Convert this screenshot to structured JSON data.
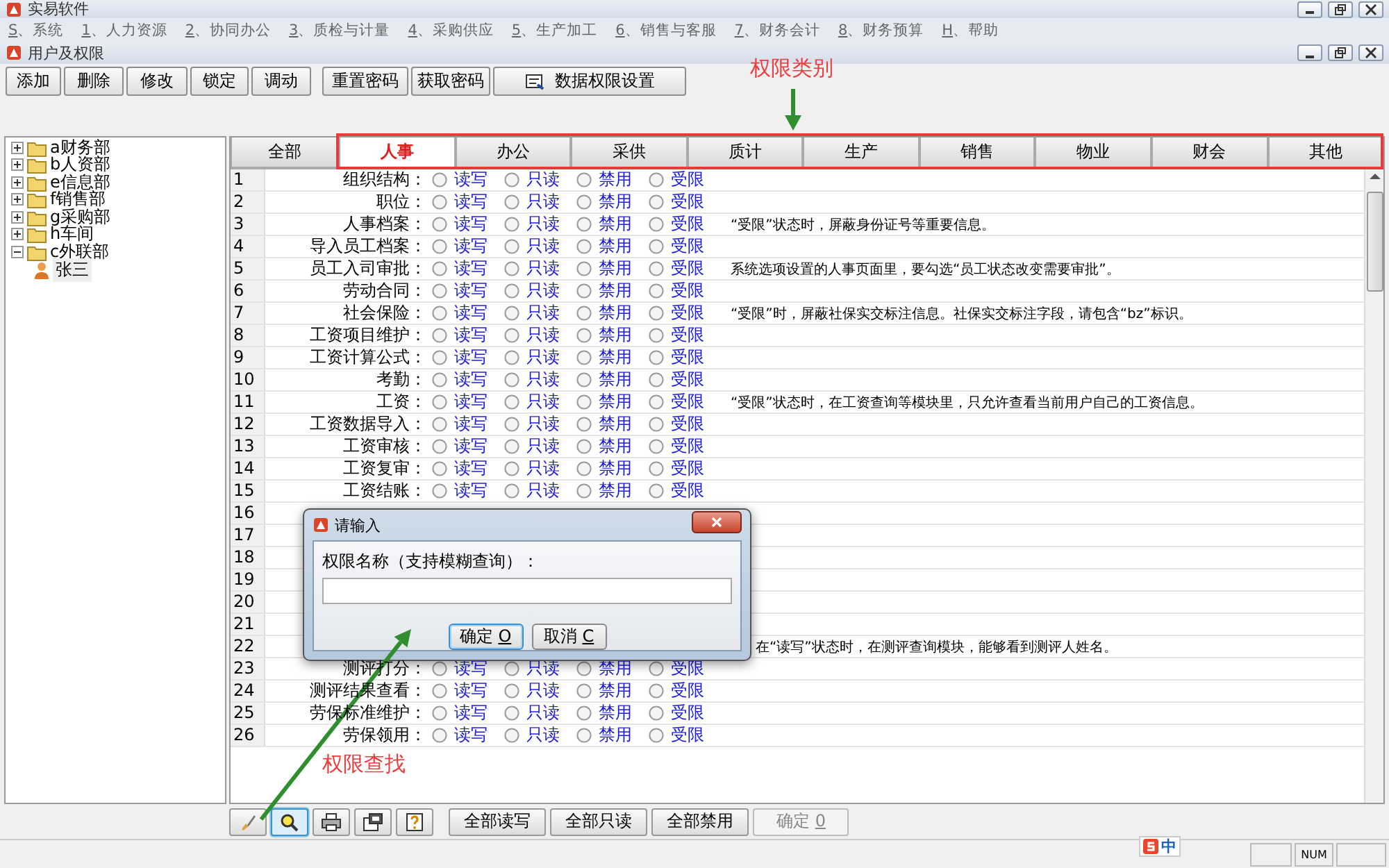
{
  "window": {
    "title": "实易软件"
  },
  "menu": [
    {
      "key": "S",
      "label": "、系统"
    },
    {
      "key": "1",
      "label": "、人力资源"
    },
    {
      "key": "2",
      "label": "、协同办公"
    },
    {
      "key": "3",
      "label": "、质检与计量"
    },
    {
      "key": "4",
      "label": "、采购供应"
    },
    {
      "key": "5",
      "label": "、生产加工"
    },
    {
      "key": "6",
      "label": "、销售与客服"
    },
    {
      "key": "7",
      "label": "、财务会计"
    },
    {
      "key": "8",
      "label": "、财务预算"
    },
    {
      "key": "H",
      "label": "、帮助"
    }
  ],
  "child_window": {
    "title": "用户及权限"
  },
  "toolbar": [
    {
      "kind": "text",
      "label": "添加"
    },
    {
      "kind": "text",
      "label": "删除"
    },
    {
      "kind": "text",
      "label": "修改"
    },
    {
      "kind": "text",
      "label": "锁定"
    },
    {
      "kind": "text",
      "label": "调动"
    },
    {
      "kind": "text",
      "label": "重置密码"
    },
    {
      "kind": "text",
      "label": "获取密码"
    },
    {
      "kind": "icon",
      "label": "数据权限设置"
    }
  ],
  "tree": [
    {
      "kind": "folder",
      "label": "a财务部",
      "expanded": false,
      "selected": false
    },
    {
      "kind": "folder",
      "label": "b人资部",
      "expanded": false,
      "selected": false
    },
    {
      "kind": "folder",
      "label": "e信息部",
      "expanded": false,
      "selected": false
    },
    {
      "kind": "folder",
      "label": "f销售部",
      "expanded": false,
      "selected": false
    },
    {
      "kind": "folder",
      "label": "g采购部",
      "expanded": false,
      "selected": false
    },
    {
      "kind": "folder",
      "label": "h车间",
      "expanded": false,
      "selected": false
    },
    {
      "kind": "folder",
      "label": "c外联部",
      "expanded": true,
      "selected": false,
      "children": [
        {
          "kind": "person",
          "label": "张三",
          "selected": true
        }
      ]
    }
  ],
  "tabs": [
    {
      "label": "全部",
      "selected": false
    },
    {
      "label": "人事",
      "selected": true
    },
    {
      "label": "办公",
      "selected": false
    },
    {
      "label": "采供",
      "selected": false
    },
    {
      "label": "质计",
      "selected": false
    },
    {
      "label": "生产",
      "selected": false
    },
    {
      "label": "销售",
      "selected": false
    },
    {
      "label": "物业",
      "selected": false
    },
    {
      "label": "财会",
      "selected": false
    },
    {
      "label": "其他",
      "selected": false
    }
  ],
  "rows": [
    {
      "number": "1",
      "label": "组织结构：",
      "options": [
        {
          "label": "读写",
          "selected": false
        },
        {
          "label": "只读",
          "selected": false
        },
        {
          "label": "禁用",
          "selected": false
        },
        {
          "label": "受限",
          "selected": false
        }
      ]
    },
    {
      "number": "2",
      "label": "职位：",
      "options": [
        {
          "label": "读写",
          "selected": false
        },
        {
          "label": "只读",
          "selected": false
        },
        {
          "label": "禁用",
          "selected": false
        },
        {
          "label": "受限",
          "selected": false
        }
      ]
    },
    {
      "number": "3",
      "label": "人事档案：",
      "options": [
        {
          "label": "读写",
          "selected": false
        },
        {
          "label": "只读",
          "selected": false
        },
        {
          "label": "禁用",
          "selected": false
        },
        {
          "label": "受限",
          "selected": false
        }
      ],
      "note": "“受限”状态时，屏蔽身份证号等重要信息。"
    },
    {
      "number": "4",
      "label": "导入员工档案：",
      "options": [
        {
          "label": "读写",
          "selected": false
        },
        {
          "label": "只读",
          "selected": false
        },
        {
          "label": "禁用",
          "selected": false
        },
        {
          "label": "受限",
          "selected": false
        }
      ]
    },
    {
      "number": "5",
      "label": "员工入司审批：",
      "options": [
        {
          "label": "读写",
          "selected": false
        },
        {
          "label": "只读",
          "selected": false
        },
        {
          "label": "禁用",
          "selected": false
        },
        {
          "label": "受限",
          "selected": false
        }
      ],
      "note": "系统选项设置的人事页面里，要勾选“员工状态改变需要审批”。"
    },
    {
      "number": "6",
      "label": "劳动合同：",
      "options": [
        {
          "label": "读写",
          "selected": false
        },
        {
          "label": "只读",
          "selected": false
        },
        {
          "label": "禁用",
          "selected": false
        },
        {
          "label": "受限",
          "selected": false
        }
      ]
    },
    {
      "number": "7",
      "label": "社会保险：",
      "options": [
        {
          "label": "读写",
          "selected": false
        },
        {
          "label": "只读",
          "selected": false
        },
        {
          "label": "禁用",
          "selected": false
        },
        {
          "label": "受限",
          "selected": false
        }
      ],
      "note": "“受限”时，屏蔽社保实交标注信息。社保实交标注字段，请包含“bz”标识。"
    },
    {
      "number": "8",
      "label": "工资项目维护：",
      "options": [
        {
          "label": "读写",
          "selected": false
        },
        {
          "label": "只读",
          "selected": false
        },
        {
          "label": "禁用",
          "selected": false
        },
        {
          "label": "受限",
          "selected": false
        }
      ]
    },
    {
      "number": "9",
      "label": "工资计算公式：",
      "options": [
        {
          "label": "读写",
          "selected": false
        },
        {
          "label": "只读",
          "selected": false
        },
        {
          "label": "禁用",
          "selected": false
        },
        {
          "label": "受限",
          "selected": false
        }
      ]
    },
    {
      "number": "10",
      "label": "考勤：",
      "options": [
        {
          "label": "读写",
          "selected": false
        },
        {
          "label": "只读",
          "selected": false
        },
        {
          "label": "禁用",
          "selected": false
        },
        {
          "label": "受限",
          "selected": false
        }
      ]
    },
    {
      "number": "11",
      "label": "工资：",
      "options": [
        {
          "label": "读写",
          "selected": false
        },
        {
          "label": "只读",
          "selected": false
        },
        {
          "label": "禁用",
          "selected": false
        },
        {
          "label": "受限",
          "selected": false
        }
      ],
      "note": "“受限”状态时，在工资查询等模块里，只允许查看当前用户自己的工资信息。"
    },
    {
      "number": "12",
      "label": "工资数据导入：",
      "options": [
        {
          "label": "读写",
          "selected": false
        },
        {
          "label": "只读",
          "selected": false
        },
        {
          "label": "禁用",
          "selected": false
        },
        {
          "label": "受限",
          "selected": false
        }
      ]
    },
    {
      "number": "13",
      "label": "工资审核：",
      "options": [
        {
          "label": "读写",
          "selected": false
        },
        {
          "label": "只读",
          "selected": false
        },
        {
          "label": "禁用",
          "selected": false
        },
        {
          "label": "受限",
          "selected": false
        }
      ]
    },
    {
      "number": "14",
      "label": "工资复审：",
      "options": [
        {
          "label": "读写",
          "selected": false
        },
        {
          "label": "只读",
          "selected": false
        },
        {
          "label": "禁用",
          "selected": false
        },
        {
          "label": "受限",
          "selected": false
        }
      ]
    },
    {
      "number": "15",
      "label": "工资结账：",
      "options": [
        {
          "label": "读写",
          "selected": false
        },
        {
          "label": "只读",
          "selected": false
        },
        {
          "label": "禁用",
          "selected": false
        },
        {
          "label": "受限",
          "selected": false
        }
      ]
    },
    {
      "number": "16"
    },
    {
      "number": "17"
    },
    {
      "number": "18"
    },
    {
      "number": "19"
    },
    {
      "number": "20"
    },
    {
      "number": "21"
    },
    {
      "number": "22",
      "note": "在“读写”状态时，在测评查询模块，能够看到测评人姓名。"
    },
    {
      "number": "23",
      "label": "测评打分：",
      "options": [
        {
          "label": "读写",
          "selected": false
        },
        {
          "label": "只读",
          "selected": false
        },
        {
          "label": "禁用",
          "selected": false
        },
        {
          "label": "受限",
          "selected": false
        }
      ]
    },
    {
      "number": "24",
      "label": "测评结果查看：",
      "options": [
        {
          "label": "读写",
          "selected": false
        },
        {
          "label": "只读",
          "selected": false
        },
        {
          "label": "禁用",
          "selected": false
        },
        {
          "label": "受限",
          "selected": false
        }
      ]
    },
    {
      "number": "25",
      "label": "劳保标准维护：",
      "options": [
        {
          "label": "读写",
          "selected": false
        },
        {
          "label": "只读",
          "selected": false
        },
        {
          "label": "禁用",
          "selected": false
        },
        {
          "label": "受限",
          "selected": false
        }
      ]
    },
    {
      "number": "26",
      "label": "劳保领用：",
      "options": [
        {
          "label": "读写",
          "selected": false
        },
        {
          "label": "只读",
          "selected": false
        },
        {
          "label": "禁用",
          "selected": false
        },
        {
          "label": "受限",
          "selected": false
        }
      ]
    }
  ],
  "bottom_toolbar": {
    "icon_buttons": [
      {
        "kind": "brush",
        "selected": false
      },
      {
        "kind": "search",
        "selected": true
      },
      {
        "kind": "print",
        "selected": false
      },
      {
        "kind": "properties",
        "selected": false
      },
      {
        "kind": "help",
        "selected": false
      }
    ],
    "buttons": [
      {
        "label": "全部读写",
        "disabled": false
      },
      {
        "label": "全部只读",
        "disabled": false
      },
      {
        "label": "全部禁用",
        "disabled": false
      },
      {
        "label": "确定",
        "key": "0",
        "disabled": true
      }
    ]
  },
  "dialog": {
    "title": "请输入",
    "prompt": "权限名称（支持模糊查询）：",
    "buttons": [
      {
        "label": "确定",
        "key": "O",
        "focused": true
      },
      {
        "label": "取消",
        "key": "C",
        "focused": false
      }
    ]
  },
  "status_bar": {
    "ime": "中",
    "num": "NUM"
  },
  "annotations": [
    {
      "text": "权限类别"
    },
    {
      "text": "权限查找"
    }
  ]
}
